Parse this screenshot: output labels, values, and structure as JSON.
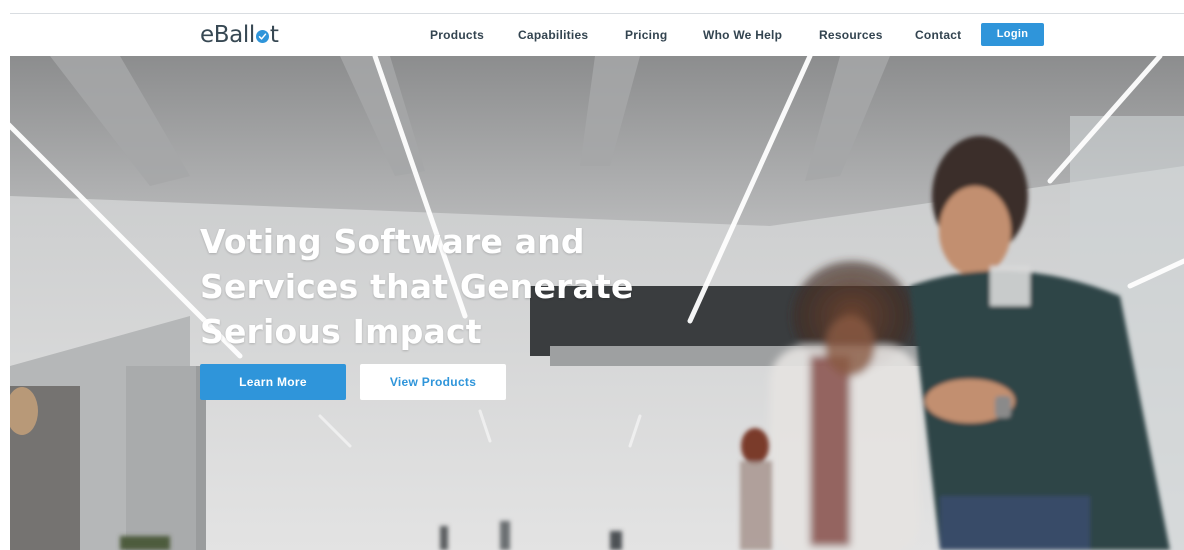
{
  "header": {
    "logo": {
      "text_before": "eBall",
      "text_after": "t",
      "mark": "checkmark-circle-icon"
    },
    "nav": [
      {
        "label": "Products"
      },
      {
        "label": "Capabilities"
      },
      {
        "label": "Pricing"
      },
      {
        "label": "Who We Help"
      },
      {
        "label": "Resources"
      },
      {
        "label": "Contact"
      }
    ],
    "login_label": "Login"
  },
  "hero": {
    "headline_lines": [
      "Voting Software and",
      "Services that Generate",
      "Serious Impact"
    ],
    "learn_more_label": "Learn More",
    "view_products_label": "View Products"
  },
  "colors": {
    "accent": "#2f95da",
    "nav_text": "#334450",
    "logo_text": "#374853",
    "hero_text": "#ffffff"
  }
}
